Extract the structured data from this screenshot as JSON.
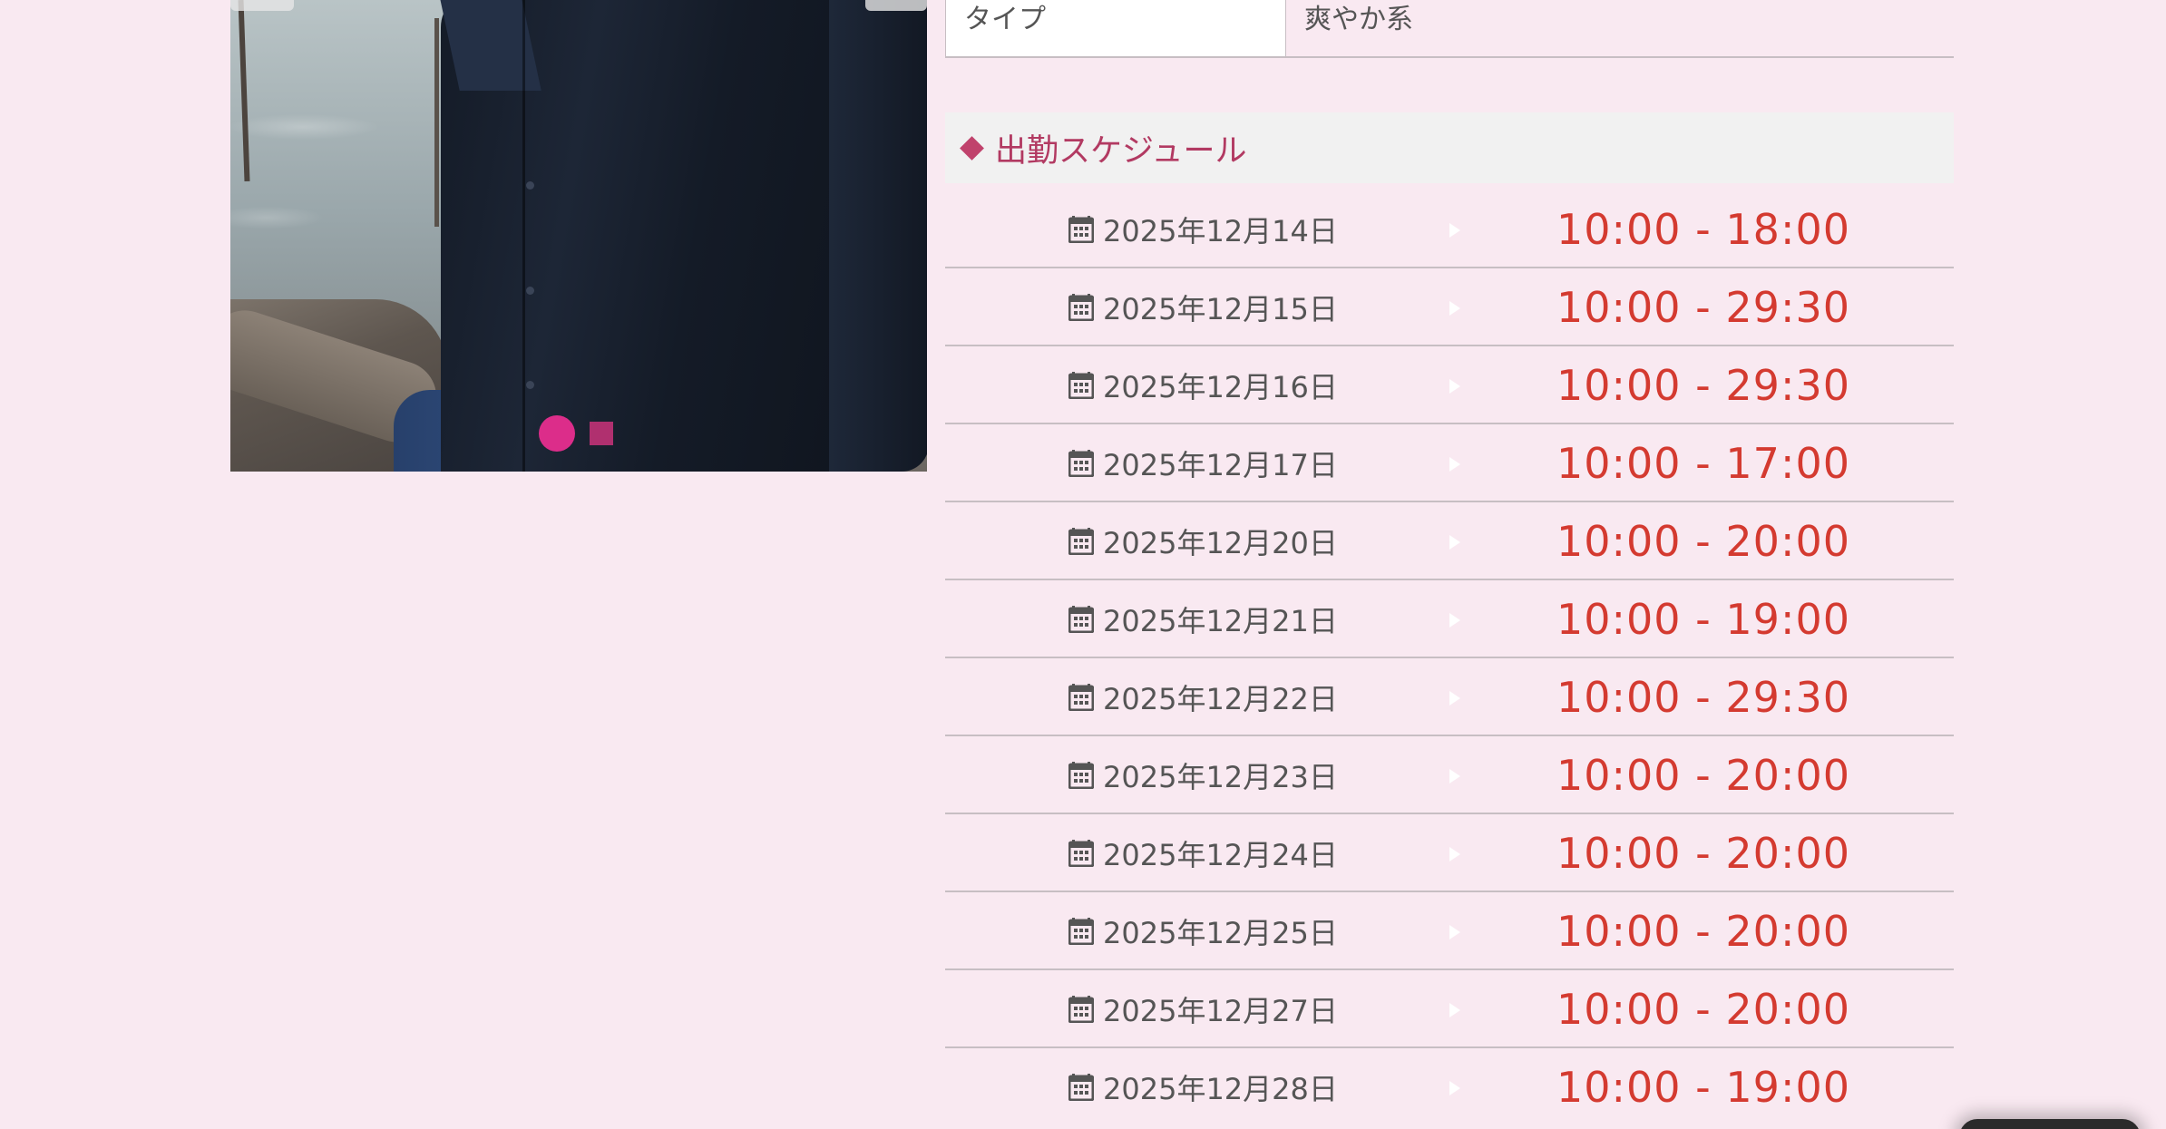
{
  "profile": {
    "type_label": "タイプ",
    "type_value": "爽やか系"
  },
  "gallery": {
    "indicator_count": 2,
    "active_index": 0
  },
  "schedule": {
    "title": "出勤スケジュール",
    "rows": [
      {
        "date": "2025年12月14日",
        "time": "10:00 - 18:00"
      },
      {
        "date": "2025年12月15日",
        "time": "10:00 - 29:30"
      },
      {
        "date": "2025年12月16日",
        "time": "10:00 - 29:30"
      },
      {
        "date": "2025年12月17日",
        "time": "10:00 - 17:00"
      },
      {
        "date": "2025年12月20日",
        "time": "10:00 - 20:00"
      },
      {
        "date": "2025年12月21日",
        "time": "10:00 - 19:00"
      },
      {
        "date": "2025年12月22日",
        "time": "10:00 - 29:30"
      },
      {
        "date": "2025年12月23日",
        "time": "10:00 - 20:00"
      },
      {
        "date": "2025年12月24日",
        "time": "10:00 - 20:00"
      },
      {
        "date": "2025年12月25日",
        "time": "10:00 - 20:00"
      },
      {
        "date": "2025年12月27日",
        "time": "10:00 - 20:00"
      },
      {
        "date": "2025年12月28日",
        "time": "10:00 - 19:00"
      }
    ]
  },
  "icons": {
    "row_icon": "calendar-icon",
    "section_icon": "diamond-icon",
    "separator_icon": "triangle-right-icon"
  },
  "colors": {
    "background": "#f9e9f1",
    "accent_time": "#d43a30",
    "section_title": "#b23a62",
    "indicator_active": "#dc2d8a",
    "indicator_inactive": "#b0306f"
  }
}
